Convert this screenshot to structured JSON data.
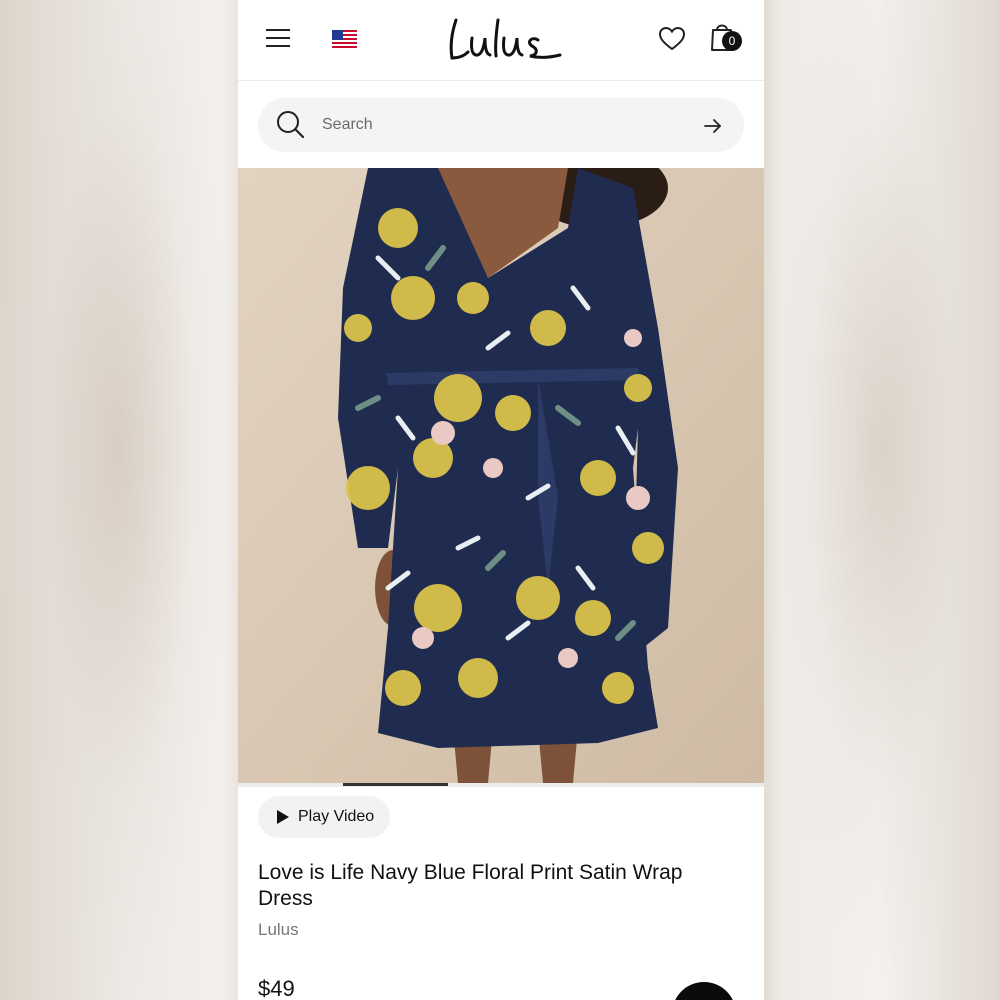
{
  "header": {
    "menu_icon": "hamburger-menu-icon",
    "flag_icon": "us-flag-icon",
    "logo_text": "Lulus",
    "wishlist_icon": "heart-icon",
    "cart_icon": "shopping-bag-icon",
    "cart_count": "0"
  },
  "search": {
    "placeholder": "Search",
    "value": "",
    "submit_icon": "arrow-right-icon"
  },
  "gallery": {
    "image_alt": "Love is Life Navy Blue Floral Print Satin Wrap Dress",
    "active_slide": 2,
    "total_slides": 5
  },
  "product": {
    "play_video_label": "Play Video",
    "title": "Love is Life Navy Blue Floral Print Satin Wrap Dress",
    "brand": "Lulus",
    "price": "$49"
  },
  "colors": {
    "accent": "#111111",
    "dress_navy": "#1f2b4f",
    "floral_yellow": "#d9c24a",
    "backdrop": "#dccbb7"
  }
}
